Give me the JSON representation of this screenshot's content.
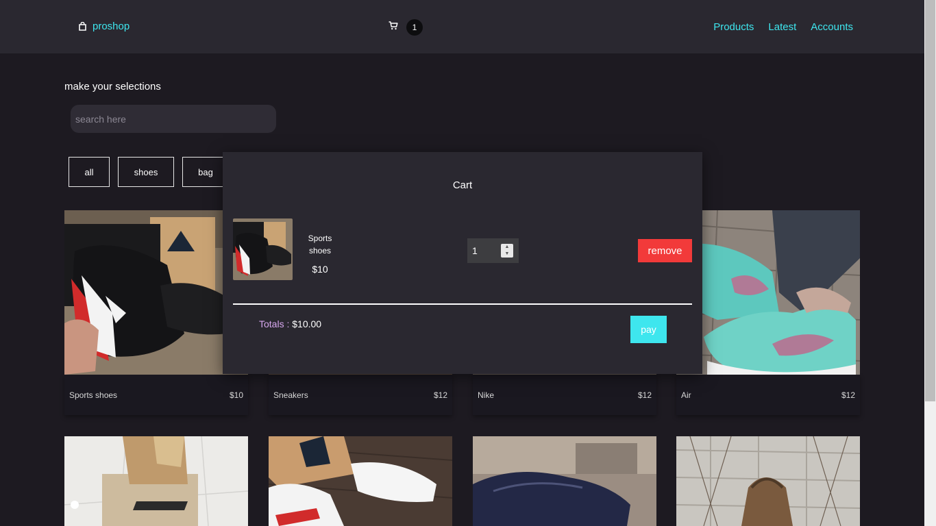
{
  "nav": {
    "brand": "proshop",
    "cart_count": "1",
    "links": [
      "Products",
      "Latest",
      "Accounts"
    ]
  },
  "main": {
    "heading": "make your selections",
    "search_placeholder": "search here",
    "filters": [
      "all",
      "shoes",
      "bag"
    ]
  },
  "products": [
    {
      "name": "Sports shoes",
      "price": "$10"
    },
    {
      "name": "Sneakers",
      "price": "$12"
    },
    {
      "name": "Nike",
      "price": "$12"
    },
    {
      "name": "Air",
      "price": "$12"
    }
  ],
  "cart_modal": {
    "title": "Cart",
    "item": {
      "name": "Sports shoes",
      "price": "$10",
      "quantity": "1"
    },
    "remove_label": "remove",
    "totals_label": "Totals :",
    "totals_value": "$10.00",
    "pay_label": "pay"
  },
  "colors": {
    "accent": "#3ee6ee",
    "danger": "#f23a3a",
    "background": "#1d1a21",
    "panel": "#2a2830"
  },
  "icons": [
    "bag-icon",
    "cart-icon"
  ]
}
